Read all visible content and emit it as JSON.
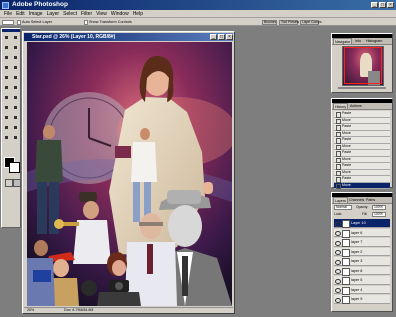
{
  "app": {
    "title": "Adobe Photoshop",
    "colors": {
      "title_bar": "#0a246a",
      "chrome": "#d4d0c8",
      "workspace": "#7e7e7e",
      "selection": "#0a246a"
    }
  },
  "menu": [
    "File",
    "Edit",
    "Image",
    "Layer",
    "Select",
    "Filter",
    "View",
    "Window",
    "Help"
  ],
  "options_bar": {
    "fields": [
      "",
      "Auto Select Layer",
      "Show Transform Controls"
    ],
    "tabs": [
      "Brushes",
      "Tool Presets",
      "Layer Comps"
    ]
  },
  "toolbox": {
    "icons": [
      "marquee-icon",
      "move-icon",
      "lasso-icon",
      "magic-wand-icon",
      "crop-icon",
      "slice-icon",
      "healing-brush-icon",
      "brush-icon",
      "stamp-icon",
      "history-brush-icon",
      "eraser-icon",
      "gradient-icon",
      "blur-icon",
      "dodge-icon",
      "path-selection-icon",
      "type-icon",
      "pen-icon",
      "shape-icon",
      "notes-icon",
      "eyedropper-icon",
      "hand-icon",
      "zoom-icon"
    ]
  },
  "document": {
    "title": "Star.psd @ 26% (Layer 10, RGB/8#)",
    "zoom": "26%",
    "status": "Doc: 8.79M/84.6M"
  },
  "navigator": {
    "tabs": [
      "Navigator",
      "Info",
      "Histogram"
    ]
  },
  "history": {
    "tabs": [
      "History",
      "Actions"
    ],
    "rows": [
      "Paste",
      "Move",
      "Paste",
      "Move",
      "Paste",
      "Move",
      "Paste",
      "Move",
      "Paste",
      "Move",
      "Paste",
      "Move"
    ]
  },
  "layers": {
    "tabs": [
      "Layers",
      "Channels",
      "Paths"
    ],
    "blend_mode": "Normal",
    "opacity_label": "Opacity:",
    "opacity": "100%",
    "lock_label": "Lock:",
    "fill_label": "Fill:",
    "fill": "100%",
    "rows": [
      "Layer 10",
      "layer 6",
      "layer 7",
      "layer 2",
      "layer 3",
      "layer 8",
      "layer 5",
      "layer 4",
      "layer 9"
    ]
  }
}
